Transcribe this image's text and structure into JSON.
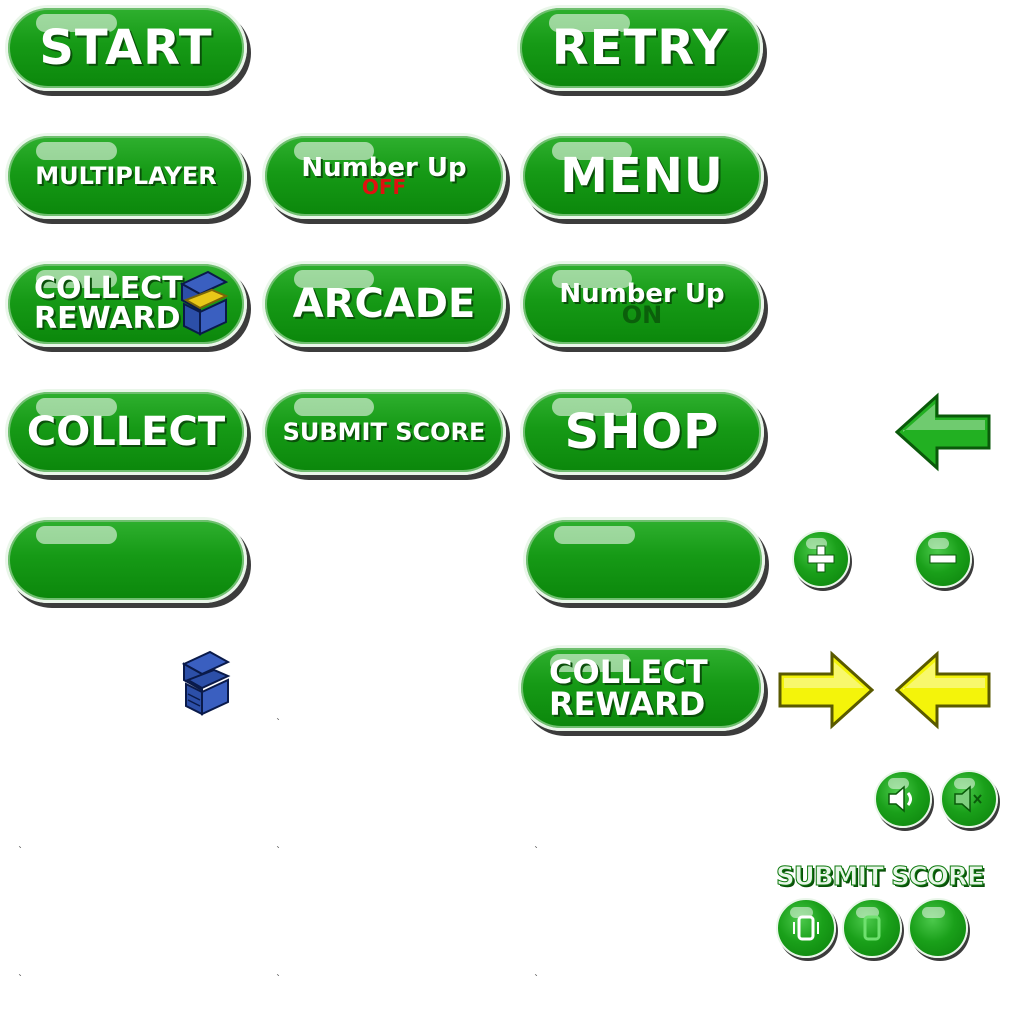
{
  "buttons": {
    "start": "START",
    "retry": "RETRY",
    "multiplayer": "MULTIPLAYER",
    "number_up_off": {
      "label": "Number Up",
      "state": "OFF"
    },
    "menu": "MENU",
    "collect_reward_chest": {
      "line1": "COLLECT",
      "line2": "REWARD"
    },
    "arcade": "ARCADE",
    "number_up_on": {
      "label": "Number Up",
      "state": "ON"
    },
    "collect": "COLLECT",
    "submit_score": "SUBMIT SCORE",
    "shop": "SHOP",
    "collect_reward": {
      "line1": "COLLECT",
      "line2": "REWARD"
    }
  },
  "submit_score_label": "SUBMIT SCORE",
  "colors": {
    "button_green": "#169a16",
    "off_red": "#e01010",
    "on_dark_green": "#0b5f0b",
    "arrow_green": "#22b022",
    "arrow_yellow": "#f4f40a",
    "chest_blue": "#2c4fa8",
    "chest_gold": "#e8c818"
  },
  "icons": [
    "treasure-chest-icon",
    "left-arrow-icon",
    "right-arrow-icon",
    "plus-icon",
    "minus-icon",
    "speaker-on-icon",
    "speaker-muted-icon",
    "phone-icon"
  ]
}
